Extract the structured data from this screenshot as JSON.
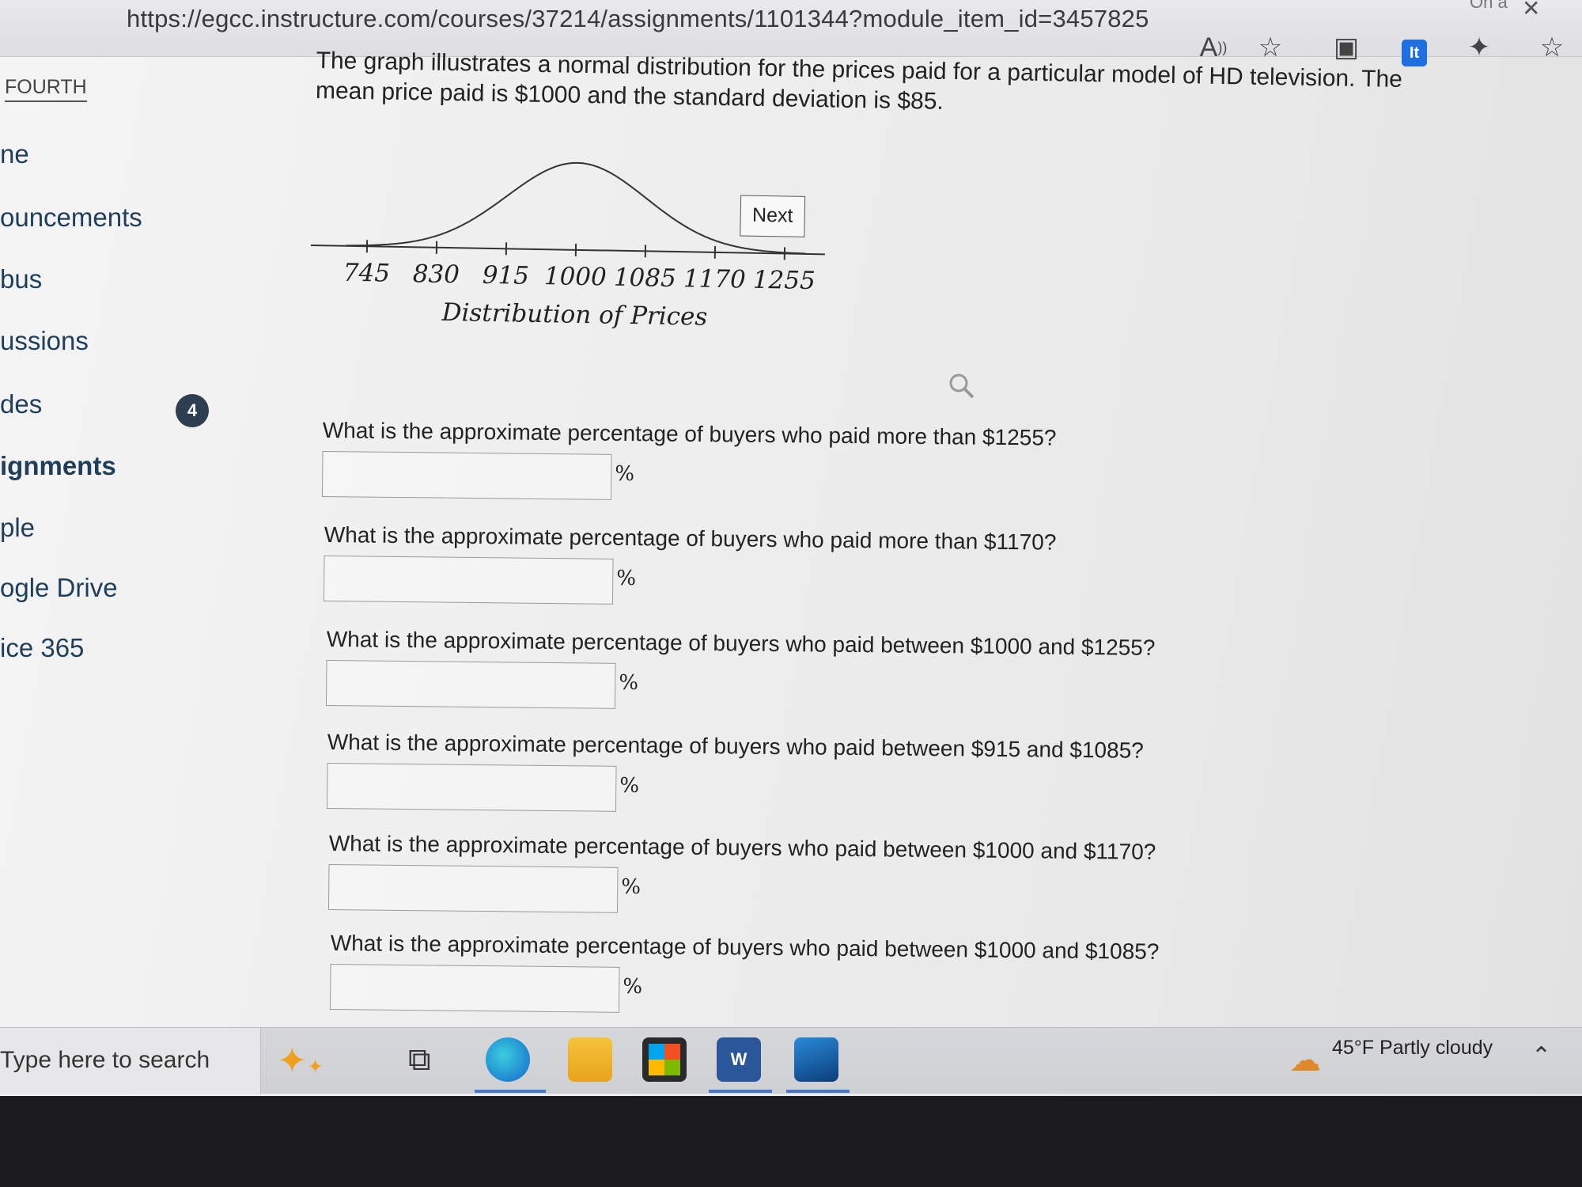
{
  "browser": {
    "url": "https://egcc.instructure.com/courses/37214/assignments/1101344?module_item_id=3457825",
    "window_tag": "On a"
  },
  "course_nav": {
    "course_label": "FOURTH",
    "items": [
      {
        "label": "ne"
      },
      {
        "label": "ouncements"
      },
      {
        "label": "bus"
      },
      {
        "label": "ussions"
      },
      {
        "label": "des"
      },
      {
        "label": "ignments"
      },
      {
        "label": "ple"
      },
      {
        "label": "ogle Drive"
      },
      {
        "label": "ice 365"
      }
    ],
    "grades_badge": "4"
  },
  "intro": "The graph illustrates a normal distribution for the prices paid for a particular model of HD television. The mean price paid is $1000 and the standard deviation is $85.",
  "chart_data": {
    "type": "line",
    "distribution": "normal",
    "mean": 1000,
    "std_dev": 85,
    "x_ticks": [
      "745",
      "830",
      "915",
      "1000",
      "1085",
      "1170",
      "1255"
    ],
    "xlabel": "Distribution of Prices",
    "xlim": [
      745,
      1255
    ]
  },
  "chart_overlay": {
    "next_label": "Next"
  },
  "questions": [
    {
      "text": "What is the approximate percentage of buyers who paid more than $1255?",
      "value": "",
      "unit": "%"
    },
    {
      "text": "What is the approximate percentage of buyers who paid more than $1170?",
      "value": "",
      "unit": "%"
    },
    {
      "text": "What is the approximate percentage of buyers who paid between $1000 and $1255?",
      "value": "",
      "unit": "%"
    },
    {
      "text": "What is the approximate percentage of buyers who paid between $915 and $1085?",
      "value": "",
      "unit": "%"
    },
    {
      "text": "What is the approximate percentage of buyers who paid between $1000 and $1170?",
      "value": "",
      "unit": "%"
    },
    {
      "text": "What is the approximate percentage of buyers who paid between $1000 and $1085?",
      "value": "",
      "unit": "%"
    }
  ],
  "taskbar": {
    "search_placeholder": "Type here to search",
    "weather": "45°F  Partly cloudy"
  },
  "colors": {
    "nav_text": "#1f3e5a",
    "badge_bg": "#2c3e50",
    "extension_blue": "#1f6fe0"
  }
}
